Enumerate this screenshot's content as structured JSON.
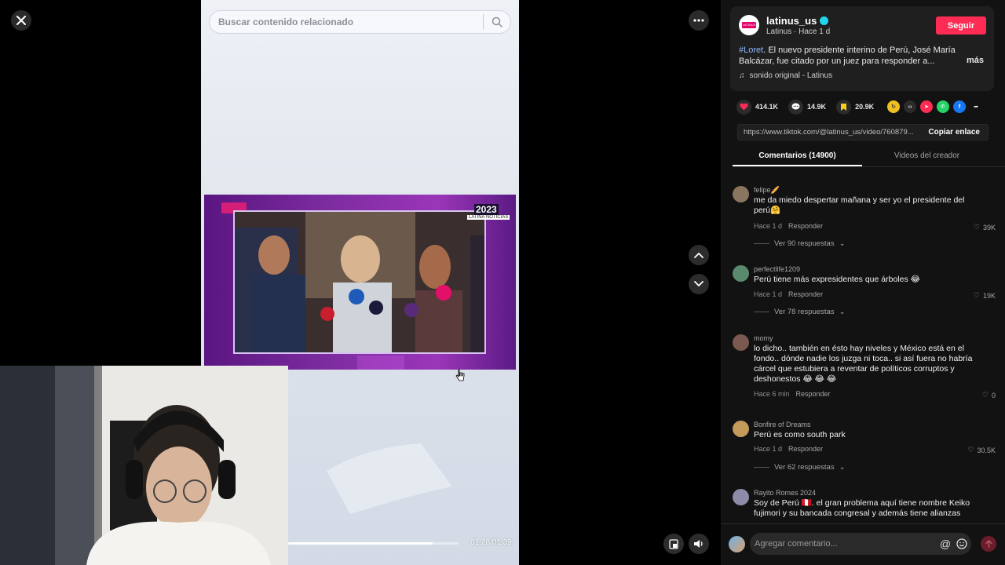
{
  "topbar": {
    "close_icon": "close-icon",
    "more_icon": "more-icon"
  },
  "search": {
    "placeholder": "Buscar contenido relacionado"
  },
  "video": {
    "embed_year": "2023",
    "embed_sub": "LATINA NOTICIAS",
    "progress": 0.85,
    "time": "01:28/01:39"
  },
  "post": {
    "username": "latinus_us",
    "subline": "Latinus · Hace 1 d",
    "follow": "Seguir",
    "hashtag": "#Loret",
    "description": ". El nuevo presidente interino de Perú, José María Balcázar, fue citado por un juez para responder a...",
    "more": "más",
    "sound": "sonido original - Latinus",
    "avatar_label": "LATINUS"
  },
  "actions": {
    "likes": "414.1K",
    "comments": "14.9K",
    "saves": "20.9K",
    "link": "https://www.tiktok.com/@latinus_us/video/760879...",
    "copy": "Copiar enlace"
  },
  "tabs": {
    "comments": "Comentarios (14900)",
    "creator": "Videos del creador"
  },
  "comments": [
    {
      "user": "felipe🥖",
      "text": "me da miedo despertar mañana y ser yo el presidente del perú🤗",
      "time": "Hace 1 d",
      "reply": "Responder",
      "likes": "39K",
      "replies": "Ver 90 respuestas",
      "avatar_color": "#8a7560"
    },
    {
      "user": "perfectlife1209",
      "text": "Perú tiene más expresidentes que árboles 😂",
      "time": "Hace 1 d",
      "reply": "Responder",
      "likes": "19K",
      "replies": "Ver 78 respuestas",
      "avatar_color": "#5a8a6e"
    },
    {
      "user": "momy",
      "text": "lo dicho.. también en ésto hay niveles y México está en el fondo.. dónde nadie los juzga ni toca.. si así fuera no habría cárcel que estubiera a reventar de políticos corruptos y deshonestos 😂 😂 😂",
      "time": "Hace 6 min",
      "reply": "Responder",
      "likes": "0",
      "replies": "",
      "avatar_color": "#7a5a50"
    },
    {
      "user": "Bonfire of Dreams",
      "text": "Perú es como south park",
      "time": "Hace 1 d",
      "reply": "Responder",
      "likes": "30.5K",
      "replies": "Ver 62 respuestas",
      "avatar_color": "#c49a5a"
    },
    {
      "user": "Rayito Romes 2024",
      "text": "Soy de Perú 🇵🇪. el gran problema aquí tiene nombre Keiko fujimori y su bancada congresal y además tiene alianzas",
      "time": "",
      "reply": "",
      "likes": "",
      "replies": "",
      "avatar_color": "#8c8ca8"
    }
  ],
  "comment_bar": {
    "placeholder": "Agregar comentario..."
  }
}
